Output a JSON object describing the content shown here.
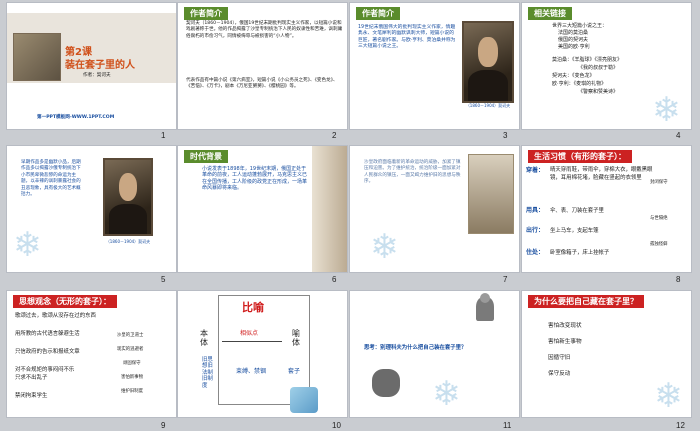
{
  "slides": [
    {
      "n": "1",
      "title": "第2课",
      "subtitle": "装在套子里的人",
      "author": "作者：契诃夫",
      "footer": "第一PPT模板网-WWW.1PPT.COM"
    },
    {
      "n": "2",
      "header": "作者简介",
      "para1": "契诃夫（1860－1904），俄国19世纪末期批判现实主义作家，以短篇小说和戏剧著称于世。他的作品揭露了沙皇专制统治下人民的奴隶性和苦难，讽刺庸俗腐朽的市侩习气，同情被侮辱与被损害的“小人物”。",
      "para2": "代表作品有中篇小说《第六病室》，短篇小说《小公务员之死》、《变色龙》、《苦恼》、《万卡》，剧本《万尼亚舅舅》、《樱桃园》等。"
    },
    {
      "n": "3",
      "header": "作者简介",
      "body": "19世纪末俄国伟大的批判现实主义作家，情趣隽永、文笔犀利的幽默讽刺大师，短篇小说的巨匠，著名剧作家。与欧·亨利、莫泊桑并称为三大短篇小说之王。",
      "caption": "（1860－1904）契诃夫"
    },
    {
      "n": "4",
      "header": "相关链接",
      "line1": "世界三大短篇小说之王：",
      "line2": "法国的莫泊桑",
      "line3": "俄国的契诃夫",
      "line4": "美国的欧·亨利",
      "line5": "莫泊桑：《羊脂球》《漂亮朋友》",
      "line6": "《我的叔叔于勒》",
      "line7": "契诃夫：《变色龙》",
      "line8": "欧·亨利：《麦琪的礼物》",
      "line9": "《警察和赞美诗》"
    },
    {
      "n": "5",
      "body": "早期作品多是幽默小品，后期作品多以揭露沙俄专制统治下小市民卑微悲惨的命运为主题，以辛辣的讽刺暴露社会的丑恶现象，具有极大的艺术概括力。",
      "caption": "（1860－1904）契诃夫"
    },
    {
      "n": "6",
      "header": "时代背景",
      "body": "小说发表于1898年，19世纪末期，俄国正处于革命的前夜，工人运动蓬勃展开，马克思主义已在全国传播，工人阶级的政党正在形成，一场革命风暴即将来临。"
    },
    {
      "n": "7",
      "body": "沙皇政府面临着新的革命运动的威胁，加紧了镇压和迫害。为了维护统治，统治阶级一面加紧对人民群众的镇压，一面又竭力维护旧的思想与秩序。"
    },
    {
      "n": "8",
      "header": "生活习惯（有形的套子）：",
      "label1": "穿着：",
      "text1": "晴天穿雨鞋，带雨伞，穿棉大衣，眼戴黑眼镜，耳用棉花堵，脸藏在竖起的衣领里",
      "note1": "封闭保守",
      "label2": "用具：",
      "text2": "伞、表、刀装在套子里",
      "note2": "与世隔绝",
      "label3": "出行：",
      "text3": "坐上马车，支起车篷",
      "label4": "住处：",
      "text4": "卧室像箱子，床上挂帐子",
      "note3": "孤独怪僻"
    },
    {
      "n": "9",
      "header": "思想观念（无形的套子）：",
      "line1": "歌颂过去，歌颂从没存在过的东西",
      "line2": "用所教的古代语言躲避生活",
      "line3": "只信政府的告示和报纸文章",
      "line4": "对不合规矩的事闷闷不乐",
      "line5": "只求不出乱子",
      "line6": "禁闭拘束学生",
      "note1": "沙皇的卫道士",
      "note2": "现实的逃避者",
      "note3": "顽固保守",
      "note4": "害怕新事物",
      "note5": "维护旧制度"
    },
    {
      "n": "10",
      "title": "比喻",
      "left": "本体",
      "right": "喻体",
      "mid": "相似点",
      "left2": "旧思想旧法制旧制度",
      "mid2": "束缚、禁锢",
      "right2": "套子"
    },
    {
      "n": "11",
      "question": "思考：别理科夫为什么把自己装在套子里？"
    },
    {
      "n": "12",
      "header": "为什么要把自己藏在套子里？",
      "line1": "害怕改变现状",
      "line2": "害怕新生事物",
      "line3": "因循守旧",
      "line4": "保守反动"
    }
  ]
}
